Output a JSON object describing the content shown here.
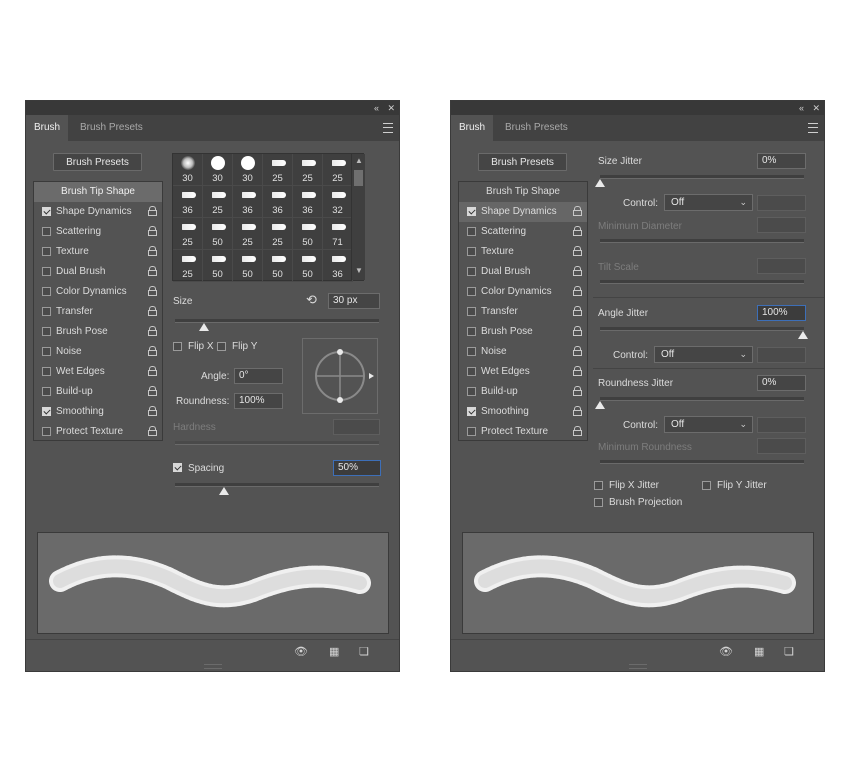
{
  "left": {
    "tabs": [
      "Brush",
      "Brush Presets"
    ],
    "presets_button": "Brush Presets",
    "list_header": "Brush Tip Shape",
    "list": [
      {
        "label": "Shape Dynamics",
        "checked": true
      },
      {
        "label": "Scattering",
        "checked": false
      },
      {
        "label": "Texture",
        "checked": false
      },
      {
        "label": "Dual Brush",
        "checked": false
      },
      {
        "label": "Color Dynamics",
        "checked": false
      },
      {
        "label": "Transfer",
        "checked": false
      },
      {
        "label": "Brush Pose",
        "checked": false
      },
      {
        "label": "Noise",
        "checked": false
      },
      {
        "label": "Wet Edges",
        "checked": false
      },
      {
        "label": "Build-up",
        "checked": false
      },
      {
        "label": "Smoothing",
        "checked": true
      },
      {
        "label": "Protect Texture",
        "checked": false
      }
    ],
    "tips": [
      "30",
      "30",
      "30",
      "25",
      "25",
      "25",
      "36",
      "25",
      "36",
      "36",
      "36",
      "32",
      "25",
      "50",
      "25",
      "25",
      "50",
      "71",
      "25",
      "50",
      "50",
      "50",
      "50",
      "36"
    ],
    "size_label": "Size",
    "size_value": "30 px",
    "flip_x": "Flip X",
    "flip_y": "Flip Y",
    "angle_label": "Angle:",
    "angle_value": "0°",
    "roundness_label": "Roundness:",
    "roundness_value": "100%",
    "hardness_label": "Hardness",
    "spacing_label": "Spacing",
    "spacing_value": "50%",
    "size_slider_fraction": 0.14,
    "spacing_slider_fraction": 0.24
  },
  "right": {
    "tabs": [
      "Brush",
      "Brush Presets"
    ],
    "presets_button": "Brush Presets",
    "list_header": "Brush Tip Shape",
    "list": [
      {
        "label": "Shape Dynamics",
        "checked": true
      },
      {
        "label": "Scattering",
        "checked": false
      },
      {
        "label": "Texture",
        "checked": false
      },
      {
        "label": "Dual Brush",
        "checked": false
      },
      {
        "label": "Color Dynamics",
        "checked": false
      },
      {
        "label": "Transfer",
        "checked": false
      },
      {
        "label": "Brush Pose",
        "checked": false
      },
      {
        "label": "Noise",
        "checked": false
      },
      {
        "label": "Wet Edges",
        "checked": false
      },
      {
        "label": "Build-up",
        "checked": false
      },
      {
        "label": "Smoothing",
        "checked": true
      },
      {
        "label": "Protect Texture",
        "checked": false
      }
    ],
    "size_jitter_label": "Size Jitter",
    "size_jitter_value": "0%",
    "control_label": "Control:",
    "control_value": "Off",
    "min_diameter_label": "Minimum Diameter",
    "tilt_scale_label": "Tilt Scale",
    "angle_jitter_label": "Angle Jitter",
    "angle_jitter_value": "100%",
    "roundness_jitter_label": "Roundness Jitter",
    "roundness_jitter_value": "0%",
    "min_roundness_label": "Minimum Roundness",
    "flip_x_jitter": "Flip X Jitter",
    "flip_y_jitter": "Flip Y Jitter",
    "brush_projection": "Brush Projection"
  },
  "colors": {
    "panel": "#535353",
    "titlebar": "#383838",
    "tabbar": "#424242",
    "focus": "#3d6fb8"
  }
}
